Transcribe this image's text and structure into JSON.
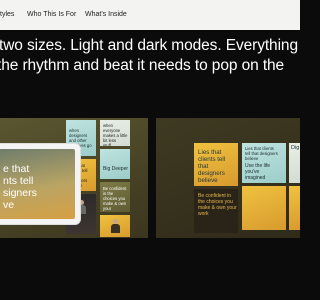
{
  "nav": {
    "items": [
      "tyles",
      "Who This Is For",
      "What's Inside"
    ]
  },
  "hero": {
    "line1": "two sizes. Light and dark modes. Everything y",
    "line2": "the rhythm and beat it needs to pop on the"
  },
  "left_mockup": {
    "tablet_text": [
      "e that",
      "nts tell",
      "signers",
      "ve"
    ],
    "tiles": {
      "t1": "when designers and other creatives go to",
      "t2": [
        "when",
        "everyone",
        "makes a little",
        "bit less",
        "stuff"
      ],
      "t3": "Big Deeper",
      "t4": "Lies that clients tell that designers believe",
      "t5": "Be confident in the choices you make & own your"
    }
  },
  "right_mockup": {
    "tiles": {
      "big": [
        "Lies that",
        "clients tell",
        "that",
        "designers",
        "believe"
      ],
      "t2": [
        "Be confident in",
        "the choices you",
        "make & own your",
        "work"
      ],
      "t3": [
        "Lies that clients",
        "tell that designers",
        "believe",
        "Use the life",
        "you've",
        "imagined"
      ],
      "t4": "Dig"
    }
  },
  "colors": {
    "background": "#0b0b0b",
    "nav_bg": "#f3f3f1",
    "gold": "#e2a836",
    "aqua": "#bfe3e0"
  }
}
